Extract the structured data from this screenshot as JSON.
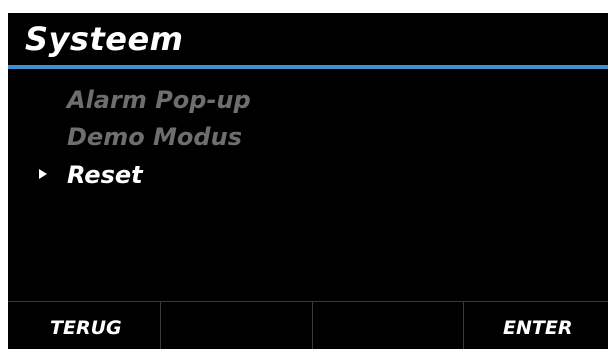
{
  "header": {
    "title": "Systeem",
    "accent_color": "#3f8fd4"
  },
  "menu": {
    "selected_index": 2,
    "items": [
      {
        "label": "Alarm Pop-up",
        "selected": false
      },
      {
        "label": "Demo Modus",
        "selected": false
      },
      {
        "label": "Reset",
        "selected": true
      }
    ]
  },
  "softkeys": {
    "left_label": "TERUG",
    "second_label": "",
    "third_label": "",
    "right_label": "ENTER"
  },
  "colors": {
    "background": "#000000",
    "text_active": "#ffffff",
    "text_inactive": "#6e6e6e"
  }
}
